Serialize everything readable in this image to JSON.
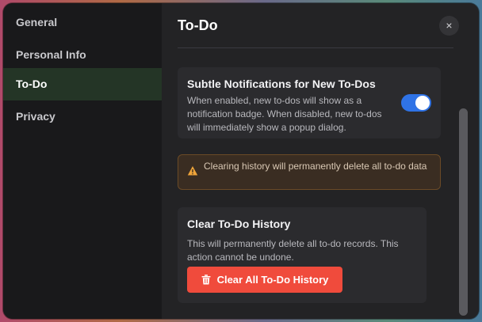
{
  "sidebar": {
    "items": [
      {
        "label": "General"
      },
      {
        "label": "Personal Info"
      },
      {
        "label": "To-Do"
      },
      {
        "label": "Privacy"
      }
    ],
    "active_item": "To-Do"
  },
  "header": {
    "title": "To-Do",
    "close_icon": "×"
  },
  "notifications_setting": {
    "title": "Subtle Notifications for New To-Dos",
    "description": "When enabled, new to-dos will show as a notification badge. When disabled, new to-dos will immediately show a popup dialog.",
    "toggle_on": true
  },
  "warning": {
    "icon": "warning-icon",
    "text": "Clearing history will permanently delete all to-do data"
  },
  "clear_history": {
    "title": "Clear To-Do History",
    "description": "This will permanently delete all to-do records. This action cannot be undone.",
    "button_label": "Clear All To-Do History",
    "button_icon": "trash-icon"
  },
  "colors": {
    "accent_toggle": "#2f73e6",
    "danger": "#f04b3c",
    "active_nav": "#243526",
    "warning_border": "#6b4a26"
  }
}
